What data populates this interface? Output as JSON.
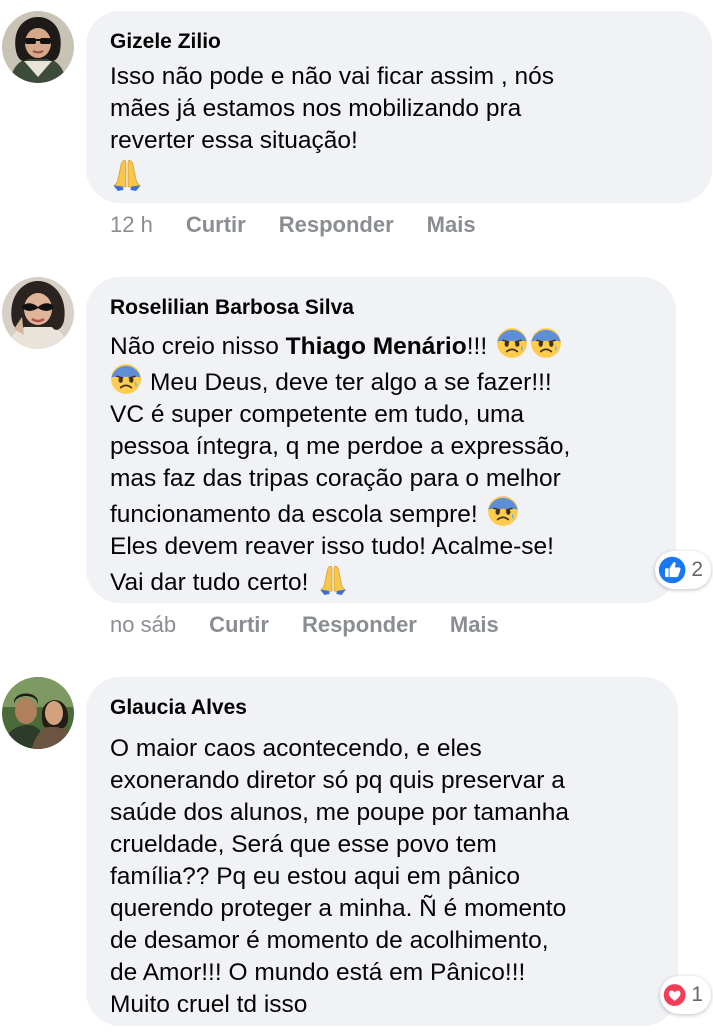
{
  "comments": [
    {
      "author": "Gizele Zilio",
      "text_lines": [
        "Isso não pode e não vai ficar assim , nós",
        "mães já estamos nos mobilizando pra",
        "reverter essa situação!"
      ],
      "time": "12 h",
      "actions": [
        "Curtir",
        "Responder",
        "Mais"
      ]
    },
    {
      "author": "Roselilian Barbosa Silva",
      "text_line1_a": "Não creio nisso ",
      "mention": "Thiago Menário",
      "text_line1_b": "!!!",
      "text_line2": "Meu Deus, deve ter algo a se fazer!!!",
      "text_lines": [
        "VC é super competente em tudo, uma",
        "pessoa íntegra, q me perdoe a expressão,",
        "mas faz das tripas coração para o melhor"
      ],
      "text_line6": "funcionamento da escola sempre!",
      "text_line7": "Eles devem reaver isso tudo! Acalme-se!",
      "text_line8": "Vai dar tudo certo!",
      "time": "no sáb",
      "actions": [
        "Curtir",
        "Responder",
        "Mais"
      ],
      "reaction": {
        "type": "like-icon",
        "count": "2",
        "color": "#1877f2"
      }
    },
    {
      "author": "Glaucia Alves",
      "text_lines": [
        "O maior caos acontecendo, e eles",
        "exonerando diretor só pq quis preservar a",
        "saúde dos alunos, me poupe por tamanha",
        "crueldade, Será que esse povo tem",
        "família?? Pq eu estou aqui em pânico",
        "querendo proteger a minha. Ñ é momento",
        "de desamor é momento de acolhimento,",
        "de Amor!!! O mundo está em Pânico!!!",
        "Muito cruel td isso"
      ],
      "reaction": {
        "type": "heart-icon",
        "count": "1",
        "color": "#f33e58"
      }
    }
  ],
  "colors": {
    "bubble": "#f0f2f5",
    "meta": "#8a8d91",
    "like": "#1877f2",
    "love": "#f33e58"
  }
}
